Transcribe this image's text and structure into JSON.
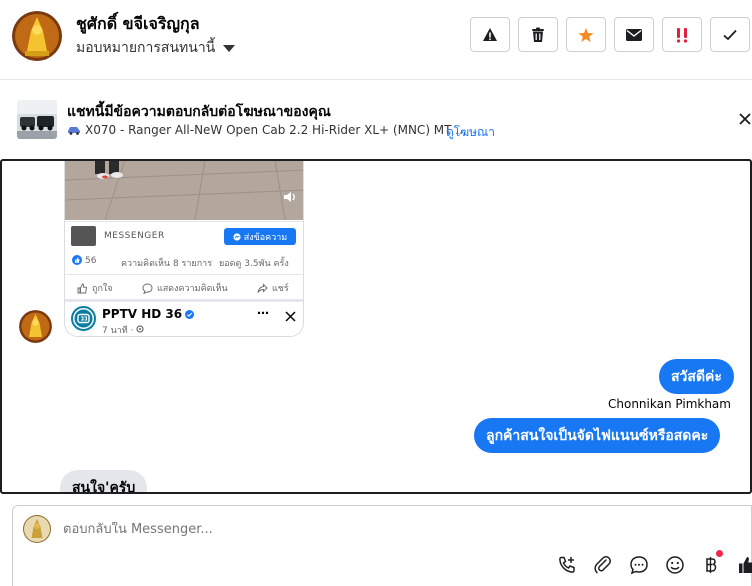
{
  "header": {
    "contact_name": "ชูศักดิ์ ขจีเจริญกุล",
    "assign_label": "มอบหมายการสนทนานี้"
  },
  "ad_banner": {
    "title": "แชทนี้มีข้อความตอบกลับต่อโฆษณาของคุณ",
    "ad_text": "X070 - Ranger All-NeW Open Cab 2.2 Hi-Rider XL+ (MNC) MT ...",
    "view_ad_label": "ดูโฆษณา"
  },
  "shared_post": {
    "messenger_label": "MESSENGER",
    "send_message_label": "ส่งข้อความ",
    "reactions_count": "56",
    "comments_text": "ความคิดเห็น 8 รายการ",
    "views_text": "ยอดดู 3.5พัน ครั้ง",
    "like_label": "ถูกใจ",
    "comment_label": "แสดงความคิดเห็น",
    "share_label": "แชร์",
    "page_name": "PPTV HD 36",
    "time_text": "7 นาที ·"
  },
  "messages": [
    {
      "direction": "out",
      "text": "สวัสดีค่ะ"
    },
    {
      "direction": "out",
      "sender": "Chonnikan Pimkham",
      "text": "ลูกค้าสนใจเป็นจัดไฟแนนซ์หรือสดคะ"
    },
    {
      "direction": "in",
      "text": "สนใจ'ครับ"
    }
  ],
  "composer": {
    "placeholder": "ตอบกลับใน Messenger..."
  },
  "colors": {
    "accent": "#1877f2",
    "incoming_bubble": "#e4e6eb",
    "star": "#f28c28",
    "spam": "#e41e3f",
    "notification_dot": "#f02849"
  }
}
